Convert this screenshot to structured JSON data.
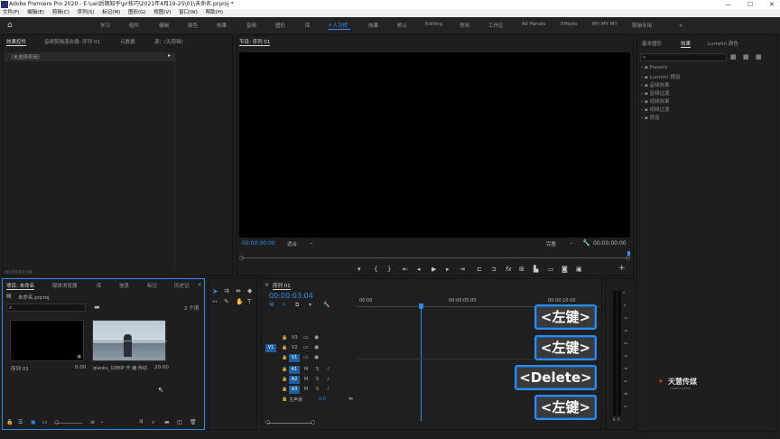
{
  "window": {
    "title": "Adobe Premiere Pro 2020 - E:\\ue\\后期知乎\\pr技巧\\2021年4月19-25\\01\\未命名.prproj *"
  },
  "menu": [
    "文件(F)",
    "编辑(E)",
    "剪辑(C)",
    "序列(S)",
    "标记(M)",
    "图形(G)",
    "视图(V)",
    "窗口(W)",
    "帮助(H)"
  ],
  "workspaces": [
    "学习",
    "组件",
    "编辑",
    "颜色",
    "效果",
    "音频",
    "图形",
    "库",
    "十人习惯",
    "效果",
    "默认",
    "Editing",
    "常用",
    "工作区",
    "All Panels",
    "Effects",
    "MY MY MY",
    "剪辑专用"
  ],
  "active_workspace_index": 8,
  "source_panel": {
    "tabs": [
      "效果控件",
      "音频剪辑混合器: 序列 01",
      "元数据",
      "源：(无剪辑)"
    ],
    "no_clip": "（未选择剪辑）",
    "timecode": "00:00:03:04"
  },
  "program": {
    "title": "节目: 序列 01",
    "timecode_left": "00:00:00:00",
    "fit": "适合",
    "quality": "完整",
    "timecode_right": "00:00:00:00"
  },
  "effects_panel": {
    "tabs": [
      "基本图形",
      "效果",
      "Lumetri 颜色"
    ],
    "folders": [
      "Presets",
      "Lumetri 预设",
      "音频效果",
      "音频过渡",
      "视频效果",
      "视频过渡",
      "预设"
    ]
  },
  "project_panel": {
    "tabs": [
      "项目: 未命名",
      "媒体浏览器",
      "库",
      "信息",
      "标记",
      "历史记"
    ],
    "file": "未命名.prproj",
    "item_count": "2 个项",
    "items": [
      {
        "name": "序列 01",
        "duration": "0:00"
      },
      {
        "name": "qianku_1080P 开 编 传动...",
        "duration": "20:00"
      }
    ]
  },
  "timeline": {
    "tab": "序列 01",
    "timecode": "00:00:03:04",
    "ruler": [
      "00:00",
      "00:00:05:00",
      "00:00:10:00"
    ],
    "video_tracks": [
      "V3",
      "V2",
      "V1"
    ],
    "audio_tracks": [
      "A1",
      "A2",
      "A3"
    ],
    "source_patch_video": "V1",
    "master": "主声道",
    "master_value": "0.0",
    "meter_labels": [
      "0",
      "-6",
      "-12",
      "-18",
      "-24",
      "-30",
      "-36",
      "-42",
      "-48",
      "-54"
    ],
    "meter_bottom": [
      "S",
      "S"
    ]
  },
  "overlay_keys": [
    "<左键>",
    "<左键>",
    "<Delete>",
    "<左键>"
  ],
  "watermark": {
    "title": "天慧传媒",
    "subtitle": "TIANHUI MEDIA"
  },
  "colors": {
    "accent": "#2d8ceb",
    "key_border": "#2d8ceb"
  }
}
